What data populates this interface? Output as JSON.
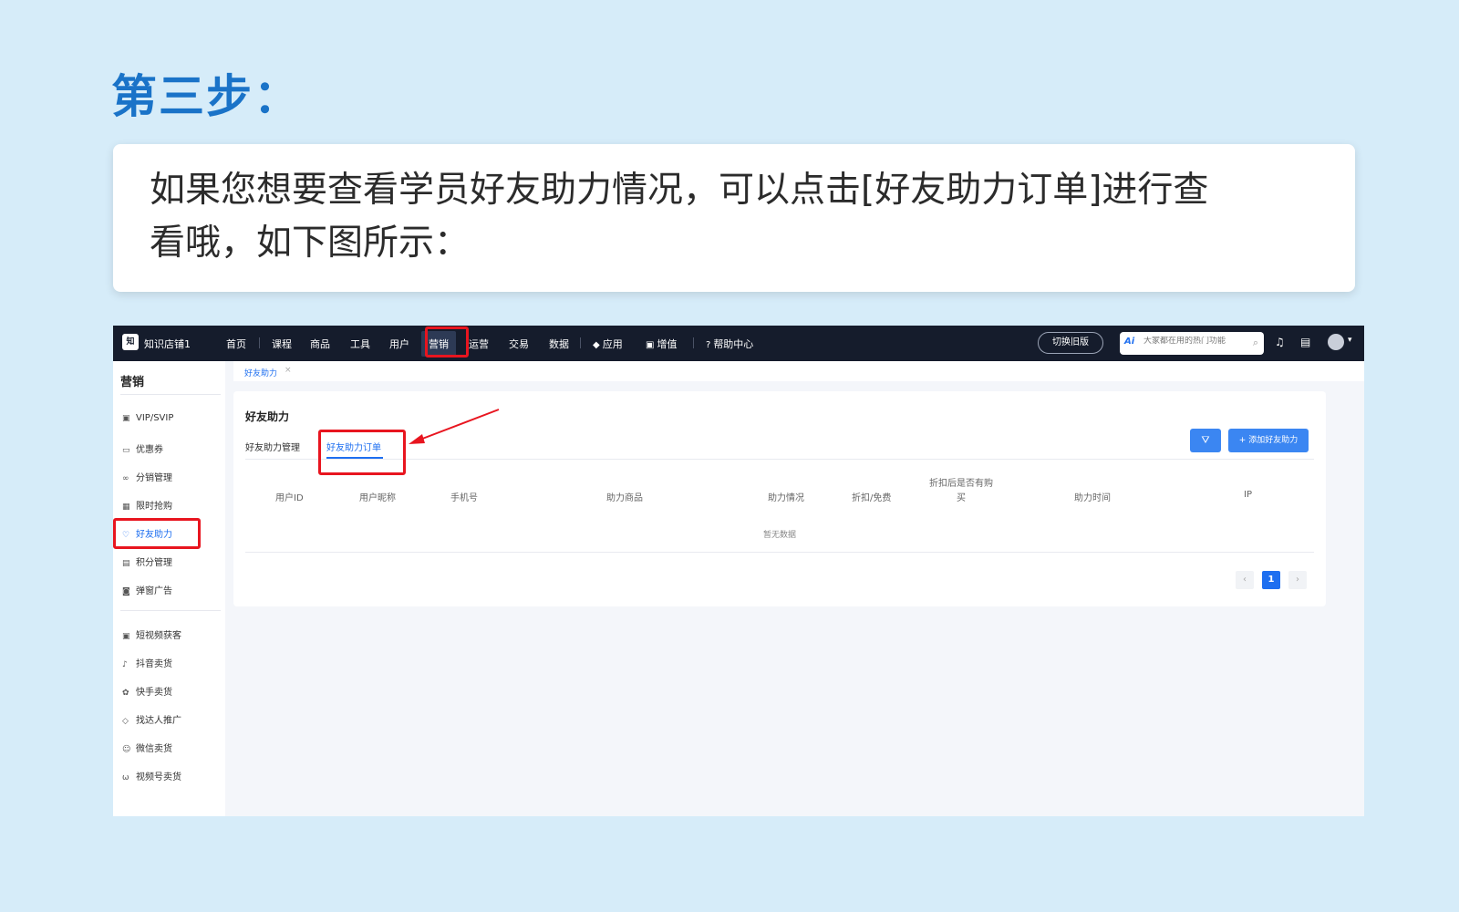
{
  "step_title": "第三步：",
  "instruction": {
    "line1": "如果您想要查看学员好友助力情况，可以点击[好友助力订单]进行查",
    "line2": "看哦，如下图所示："
  },
  "topbar": {
    "logo_text": "知",
    "shop_name": "知识店铺1",
    "nav": [
      "首页",
      "课程",
      "商品",
      "工具",
      "用户",
      "营销",
      "运营",
      "交易",
      "数据",
      "应用",
      "增值",
      "帮助中心"
    ],
    "active_nav": "营销",
    "old_version": "切换旧版",
    "ai_label": "Ai",
    "search_placeholder": "大家都在用的热门功能"
  },
  "sidebar": {
    "title": "营销",
    "group1": [
      "VIP/SVIP",
      "优惠券",
      "分销管理",
      "限时抢购",
      "好友助力",
      "积分管理",
      "弹窗广告"
    ],
    "group2": [
      "短视频获客",
      "抖音卖货",
      "快手卖货",
      "找达人推广",
      "微信卖货",
      "视频号卖货"
    ],
    "active": "好友助力"
  },
  "breadcrumb": {
    "tab": "好友助力",
    "close": "×"
  },
  "panel": {
    "title": "好友助力",
    "tabs": [
      "好友助力管理",
      "好友助力订单"
    ],
    "active_tab": "好友助力订单",
    "add_button": "+ 添加好友助力",
    "columns": [
      "用户ID",
      "用户昵称",
      "手机号",
      "助力商品",
      "助力情况",
      "折扣/免费",
      "折扣后是否有购",
      "买",
      "助力时间",
      "IP"
    ],
    "empty_text": "暂无数据",
    "pagination": {
      "prev": "‹",
      "current": "1",
      "next": "›"
    }
  },
  "colors": {
    "accent": "#1e6ff0",
    "highlight": "#e8151f",
    "title": "#1a73c8"
  }
}
